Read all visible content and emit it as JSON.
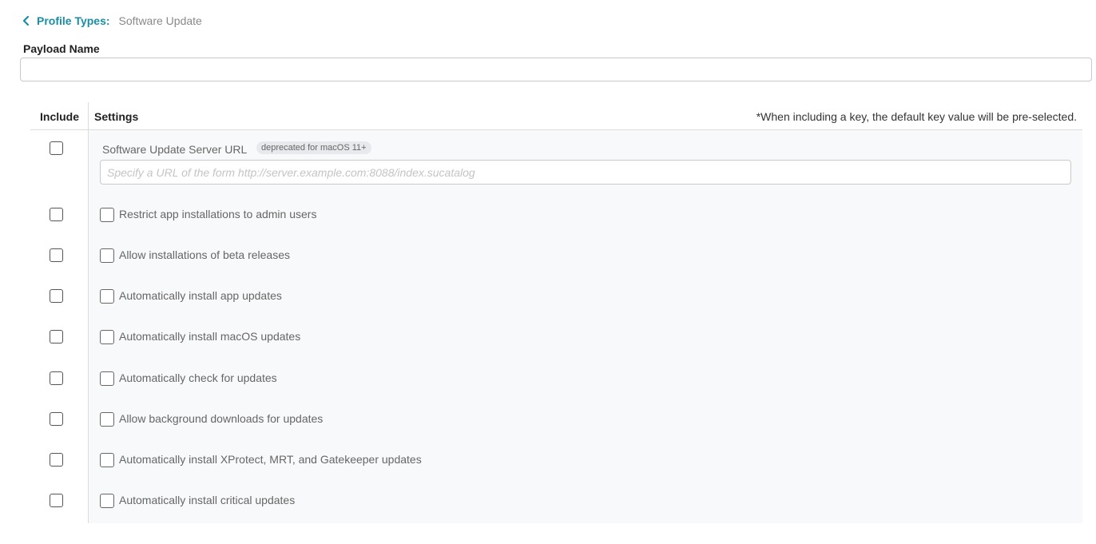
{
  "breadcrumb": {
    "back_icon": "chevron-left-icon",
    "link_label": "Profile Types:",
    "current": "Software Update"
  },
  "payload": {
    "label": "Payload Name",
    "value": "",
    "placeholder": ""
  },
  "table": {
    "header_include": "Include",
    "header_settings": "Settings",
    "note": "*When including a key, the default key value will be pre-selected."
  },
  "url_setting": {
    "label": "Software Update Server URL",
    "badge": "deprecated for macOS 11+",
    "placeholder": "Specify a URL of the form http://server.example.com:8088/index.sucatalog",
    "value": ""
  },
  "settings": [
    {
      "label": "Restrict app installations to admin users",
      "checked": false
    },
    {
      "label": "Allow installations of beta releases",
      "checked": false
    },
    {
      "label": "Automatically install app updates",
      "checked": false
    },
    {
      "label": "Automatically install macOS updates",
      "checked": false
    },
    {
      "label": "Automatically check for updates",
      "checked": false
    },
    {
      "label": "Allow background downloads for updates",
      "checked": false
    },
    {
      "label": "Automatically install XProtect, MRT, and Gatekeeper updates",
      "checked": false
    },
    {
      "label": "Automatically install critical updates",
      "checked": false
    }
  ],
  "colors": {
    "accent": "#1b8ea3",
    "panel_bg": "#f8f9fb",
    "border": "#dcdcdc"
  }
}
